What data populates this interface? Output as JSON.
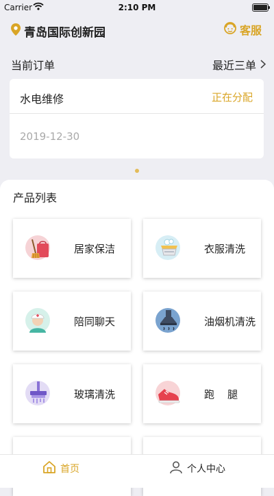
{
  "status_bar": {
    "carrier": "Carrier",
    "time": "2:10 PM"
  },
  "header": {
    "location": "青岛国际创新园",
    "service_label": "客服"
  },
  "current_order": {
    "title": "当前订单",
    "recent_link": "最近三单",
    "service": "水电维修",
    "status": "正在分配",
    "date": "2019-12-30"
  },
  "products": {
    "title": "产品列表",
    "items": [
      {
        "label": "居家保洁",
        "icon": "cleaning-icon"
      },
      {
        "label": "衣服清洗",
        "icon": "laundry-basin-icon"
      },
      {
        "label": "陪同聊天",
        "icon": "nurse-icon"
      },
      {
        "label": "油烟机清洗",
        "icon": "range-hood-icon"
      },
      {
        "label": "玻璃清洗",
        "icon": "window-cleaning-icon"
      },
      {
        "label": "跑    腿",
        "icon": "sneaker-icon"
      },
      {
        "label": "",
        "icon": ""
      },
      {
        "label": "",
        "icon": ""
      }
    ]
  },
  "tabbar": {
    "home": "首页",
    "profile": "个人中心"
  },
  "colors": {
    "accent": "#d9a526",
    "background": "#eeeef3"
  }
}
